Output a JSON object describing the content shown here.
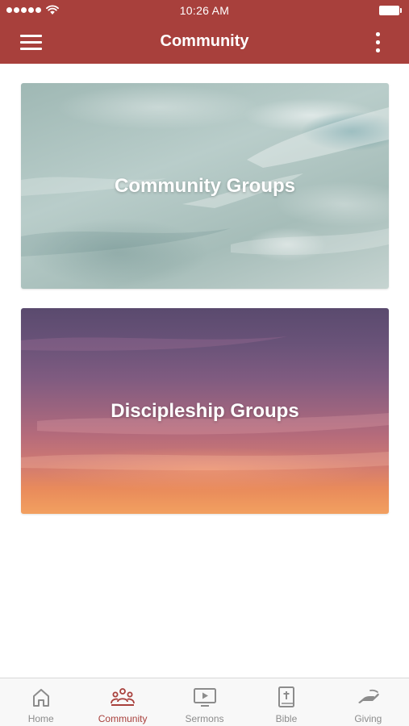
{
  "status_bar": {
    "time": "10:26 AM",
    "signal_icon": "signal-dots-icon",
    "wifi_icon": "wifi-icon",
    "battery_icon": "battery-icon"
  },
  "nav_bar": {
    "title": "Community",
    "menu_icon": "hamburger-menu-icon",
    "more_icon": "vertical-ellipsis-icon"
  },
  "cards": [
    {
      "label": "Community Groups"
    },
    {
      "label": "Discipleship Groups"
    }
  ],
  "tabs": [
    {
      "label": "Home",
      "icon": "home-icon",
      "active": false
    },
    {
      "label": "Community",
      "icon": "people-icon",
      "active": true
    },
    {
      "label": "Sermons",
      "icon": "play-screen-icon",
      "active": false
    },
    {
      "label": "Bible",
      "icon": "bible-icon",
      "active": false
    },
    {
      "label": "Giving",
      "icon": "giving-hand-icon",
      "active": false
    }
  ],
  "colors": {
    "brand": "#a8403c",
    "tab_inactive": "#8c8c8c",
    "tab_bar_bg": "#f8f8f8"
  }
}
